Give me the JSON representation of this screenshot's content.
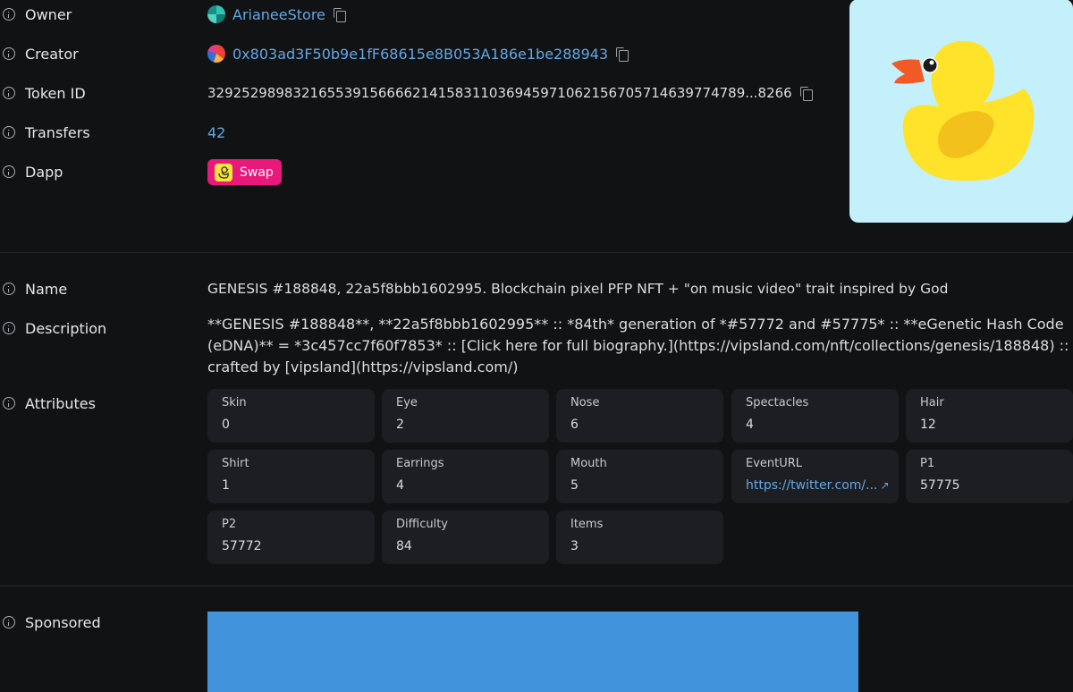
{
  "owner": {
    "label": "Owner",
    "value": "ArianeeStore"
  },
  "creator": {
    "label": "Creator",
    "value": "0x803ad3F50b9e1fF68615e8B053A186e1be288943"
  },
  "token_id": {
    "label": "Token ID",
    "value": "329252989832165539156666214158311036945971062156705714639774789...8266"
  },
  "transfers": {
    "label": "Transfers",
    "value": "42"
  },
  "dapp": {
    "label": "Dapp",
    "button_label": "Swap"
  },
  "name": {
    "label": "Name",
    "value": "GENESIS #188848, 22a5f8bbb1602995. Blockchain pixel PFP NFT + \"on music video\" trait inspired by God"
  },
  "description": {
    "label": "Description",
    "value": "**GENESIS #188848**, **22a5f8bbb1602995** :: *84th* generation of *#57772 and #57775* :: **eGenetic Hash Code (eDNA)** = *3c457cc7f60f7853* :: [Click here for full biography.](https://vipsland.com/nft/collections/genesis/188848) :: crafted by [vipsland](https://vipsland.com/)"
  },
  "attributes": {
    "label": "Attributes",
    "items": [
      {
        "name": "Skin",
        "value": "0"
      },
      {
        "name": "Eye",
        "value": "2"
      },
      {
        "name": "Nose",
        "value": "6"
      },
      {
        "name": "Spectacles",
        "value": "4"
      },
      {
        "name": "Hair",
        "value": "12"
      },
      {
        "name": "Shirt",
        "value": "1"
      },
      {
        "name": "Earrings",
        "value": "4"
      },
      {
        "name": "Mouth",
        "value": "5"
      },
      {
        "name": "EventURL",
        "value": "https://twitter.com/..."
      },
      {
        "name": "P1",
        "value": "57775"
      },
      {
        "name": "P2",
        "value": "57772"
      },
      {
        "name": "Difficulty",
        "value": "84"
      },
      {
        "name": "Items",
        "value": "3"
      }
    ]
  },
  "sponsored": {
    "label": "Sponsored"
  },
  "colors": {
    "accent_link": "#63a8e6",
    "dapp_chip": "#e8197a",
    "ad_banner": "#4194dc",
    "image_bg": "#c3f0fb"
  }
}
